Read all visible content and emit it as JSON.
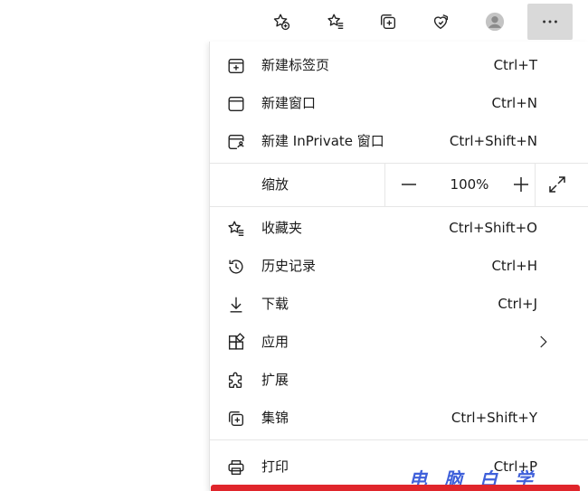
{
  "toolbar": {
    "buttons": [
      {
        "name": "add-favorite-button",
        "icon": "star-add-icon"
      },
      {
        "name": "favorites-button",
        "icon": "star-list-icon"
      },
      {
        "name": "collections-button",
        "icon": "collections-icon"
      },
      {
        "name": "browser-essentials-button",
        "icon": "heart-shield-icon"
      },
      {
        "name": "profile-button",
        "icon": "avatar-icon"
      },
      {
        "name": "settings-more-button",
        "icon": "ellipsis-icon"
      }
    ]
  },
  "menu": {
    "items": [
      {
        "label": "新建标签页",
        "shortcut": "Ctrl+T",
        "icon": "new-tab-icon"
      },
      {
        "label": "新建窗口",
        "shortcut": "Ctrl+N",
        "icon": "new-window-icon"
      },
      {
        "label": "新建 InPrivate 窗口",
        "shortcut": "Ctrl+Shift+N",
        "icon": "inprivate-icon"
      },
      {
        "label": "收藏夹",
        "shortcut": "Ctrl+Shift+O",
        "icon": "favorites-icon"
      },
      {
        "label": "历史记录",
        "shortcut": "Ctrl+H",
        "icon": "history-icon"
      },
      {
        "label": "下载",
        "shortcut": "Ctrl+J",
        "icon": "download-icon"
      },
      {
        "label": "应用",
        "shortcut": "",
        "icon": "apps-icon"
      },
      {
        "label": "扩展",
        "shortcut": "",
        "icon": "extensions-icon"
      },
      {
        "label": "集锦",
        "shortcut": "Ctrl+Shift+Y",
        "icon": "collections-icon"
      },
      {
        "label": "打印",
        "shortcut": "Ctrl+P",
        "icon": "print-icon"
      }
    ],
    "zoom": {
      "label": "缩放",
      "value": "100%",
      "minus": "—",
      "plus": "+"
    }
  },
  "watermark": "电 脑 白 学",
  "colors": {
    "highlight": "#e0252b",
    "active_button_bg": "#d9d9d9"
  }
}
